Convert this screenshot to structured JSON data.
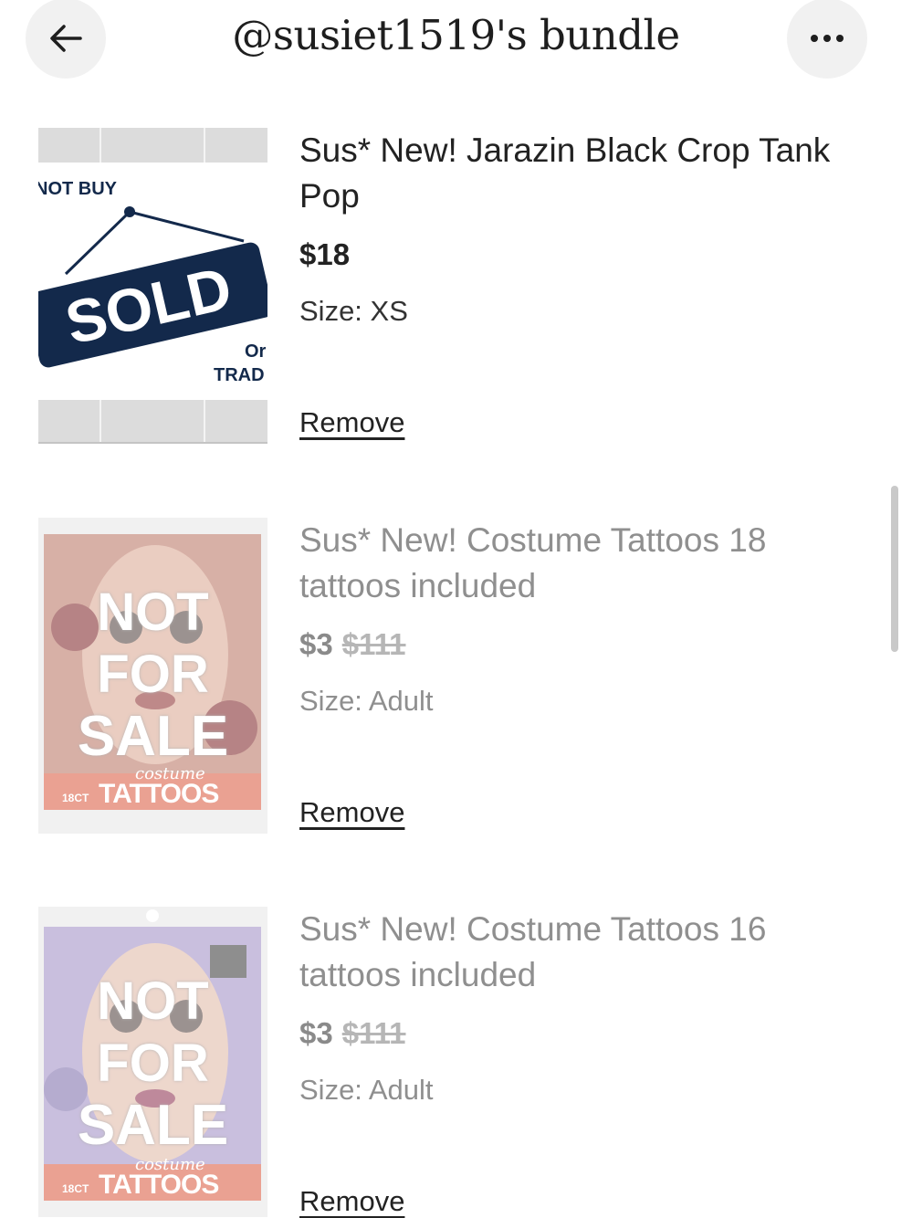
{
  "header": {
    "title": "@susiet1519's bundle",
    "back_icon": "arrow-left-icon",
    "more_icon": "more-horizontal-icon"
  },
  "items": [
    {
      "name": "Sus* New! Jarazin Black Crop Tank Pop",
      "price": "$18",
      "original_price": "",
      "size": "Size: XS",
      "remove_label": "Remove",
      "image_text": {
        "top": "NOT BUY",
        "badge": "SOLD",
        "bottom1": "Or",
        "bottom2": "TRAD"
      }
    },
    {
      "name": "Sus* New! Costume Tattoos 18 tattoos included",
      "price": "$3",
      "original_price": "$111",
      "size": "Size: Adult",
      "remove_label": "Remove",
      "image_text": {
        "overlay1": "NOT",
        "overlay2": "FOR",
        "overlay3": "SALE",
        "brand1": "costume",
        "brand2": "TATTOOS",
        "count": "18CT"
      }
    },
    {
      "name": "Sus* New! Costume Tattoos 16 tattoos included",
      "price": "$3",
      "original_price": "$111",
      "size": "Size: Adult",
      "remove_label": "Remove",
      "image_text": {
        "overlay1": "NOT",
        "overlay2": "FOR",
        "overlay3": "SALE",
        "brand1": "costume",
        "brand2": "TATTOOS",
        "count": "18CT"
      }
    }
  ],
  "colors": {
    "sold_badge": "#13294b",
    "tattoo_banner": "#d9553a",
    "header_button_bg": "#f1f1f1"
  }
}
